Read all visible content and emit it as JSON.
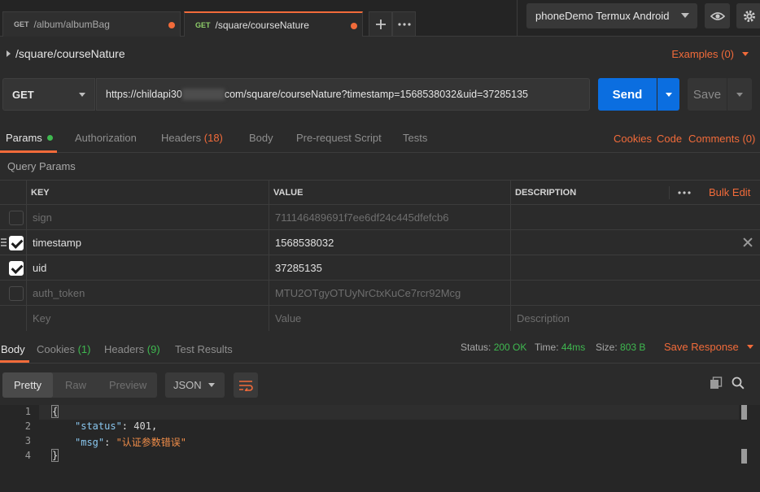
{
  "tabs": [
    {
      "method": "GET",
      "label": "/album/albumBag",
      "unsaved": true
    },
    {
      "method": "GET",
      "label": "/square/courseNature",
      "unsaved": true,
      "active": true
    }
  ],
  "tab_actions": {
    "new_tab_icon": "plus-icon",
    "more_icon": "ellipsis-icon"
  },
  "environment": {
    "selected": "phoneDemo Termux Android",
    "eye_icon": "eye-icon",
    "settings_icon": "gear-icon"
  },
  "request": {
    "name": "/square/courseNature",
    "examples_label": "Examples (0)",
    "method": "GET",
    "url_prefix": "https://childapi30",
    "url_suffix": "com/square/courseNature?timestamp=1568538032&uid=37285135",
    "send_label": "Send",
    "save_label": "Save"
  },
  "request_tabs": [
    {
      "label": "Params",
      "count": "",
      "active": true,
      "dot": true
    },
    {
      "label": "Authorization",
      "count": ""
    },
    {
      "label": "Headers",
      "count": "(18)"
    },
    {
      "label": "Body",
      "count": ""
    },
    {
      "label": "Pre-request Script",
      "count": ""
    },
    {
      "label": "Tests",
      "count": ""
    }
  ],
  "request_links": {
    "cookies": "Cookies",
    "code": "Code",
    "comments": "Comments (0)"
  },
  "query_params": {
    "title": "Query Params",
    "headers": {
      "key": "KEY",
      "value": "VALUE",
      "description": "DESCRIPTION",
      "bulk_edit": "Bulk Edit"
    },
    "rows": [
      {
        "key": "sign",
        "value": "711146489691f7ee6df24c445dfefcb6",
        "enabled": false
      },
      {
        "key": "timestamp",
        "value": "1568538032",
        "enabled": true
      },
      {
        "key": "uid",
        "value": "37285135",
        "enabled": true
      },
      {
        "key": "auth_token",
        "value": "MTU2OTgyOTUyNrCtxKuCe7rcr92Mcg",
        "enabled": false
      }
    ],
    "placeholder": {
      "key": "Key",
      "value": "Value",
      "description": "Description"
    }
  },
  "response_tabs": [
    {
      "label": "Body",
      "count": "",
      "active": true
    },
    {
      "label": "Cookies",
      "count": "(1)"
    },
    {
      "label": "Headers",
      "count": "(9)"
    },
    {
      "label": "Test Results",
      "count": ""
    }
  ],
  "response_status": {
    "status_label": "Status:",
    "status_value": "200 OK",
    "time_label": "Time:",
    "time_value": "44ms",
    "size_label": "Size:",
    "size_value": "803 B",
    "save_response": "Save Response"
  },
  "response_view": {
    "modes": [
      "Pretty",
      "Raw",
      "Preview"
    ],
    "active_mode": "Pretty",
    "format": "JSON"
  },
  "response_body": {
    "lines": [
      {
        "n": "1",
        "text": "{"
      },
      {
        "n": "2",
        "key": "\"status\"",
        "sep": ": ",
        "val": "401",
        "tail": ","
      },
      {
        "n": "3",
        "key": "\"msg\"",
        "sep": ": ",
        "str": "\"认证参数错误\""
      },
      {
        "n": "4",
        "text": "}"
      }
    ]
  },
  "colors": {
    "accent": "#f26b3a",
    "primary": "#0b6ee0",
    "success": "#3fb950",
    "background": "#2b2b2b"
  }
}
